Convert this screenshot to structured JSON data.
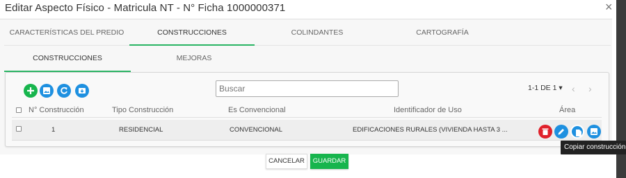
{
  "dialog": {
    "title": "Editar Aspecto Físico - Matricula NT - N° Ficha 1000000371",
    "close_glyph": "×"
  },
  "tabs": [
    {
      "label": "CARACTERÍSTICAS DEL PREDIO",
      "active": false
    },
    {
      "label": "CONSTRUCCIONES",
      "active": true
    },
    {
      "label": "COLINDANTES",
      "active": false
    },
    {
      "label": "CARTOGRAFÍA",
      "active": false
    }
  ],
  "subtabs": [
    {
      "label": "CONSTRUCCIONES",
      "active": true
    },
    {
      "label": "MEJORAS",
      "active": false
    }
  ],
  "toolbar": {
    "buttons": [
      {
        "icon": "add-icon",
        "color": "#17b54d"
      },
      {
        "icon": "image-icon",
        "color": "#1e90e0"
      },
      {
        "icon": "refresh-icon",
        "color": "#1e90e0"
      },
      {
        "icon": "archive-icon",
        "color": "#1e90e0"
      }
    ],
    "search_placeholder": "Buscar"
  },
  "pagination": {
    "range_label": "1-1 DE 1",
    "dropdown_glyph": "▾",
    "prev_glyph": "‹",
    "next_glyph": "›"
  },
  "table": {
    "columns": [
      "N° Construcción",
      "Tipo Construcción",
      "Es Convencional",
      "Identificador de Uso",
      "Área"
    ],
    "rows": [
      {
        "numero": "1",
        "tipo": "RESIDENCIAL",
        "convencional": "CONVENCIONAL",
        "uso": "EDIFICACIONES RURALES (VIVIENDA HASTA 3 ...",
        "actions": [
          {
            "icon": "delete-icon",
            "color": "#e0202a"
          },
          {
            "icon": "edit-icon",
            "color": "#1e90e0"
          },
          {
            "icon": "copy-icon",
            "color": "#1e90e0"
          },
          {
            "icon": "image-icon",
            "color": "#1e90e0"
          }
        ]
      }
    ]
  },
  "tooltip": "Copiar construcción",
  "footer": {
    "cancel_label": "CANCELAR",
    "save_label": "GUARDAR"
  }
}
